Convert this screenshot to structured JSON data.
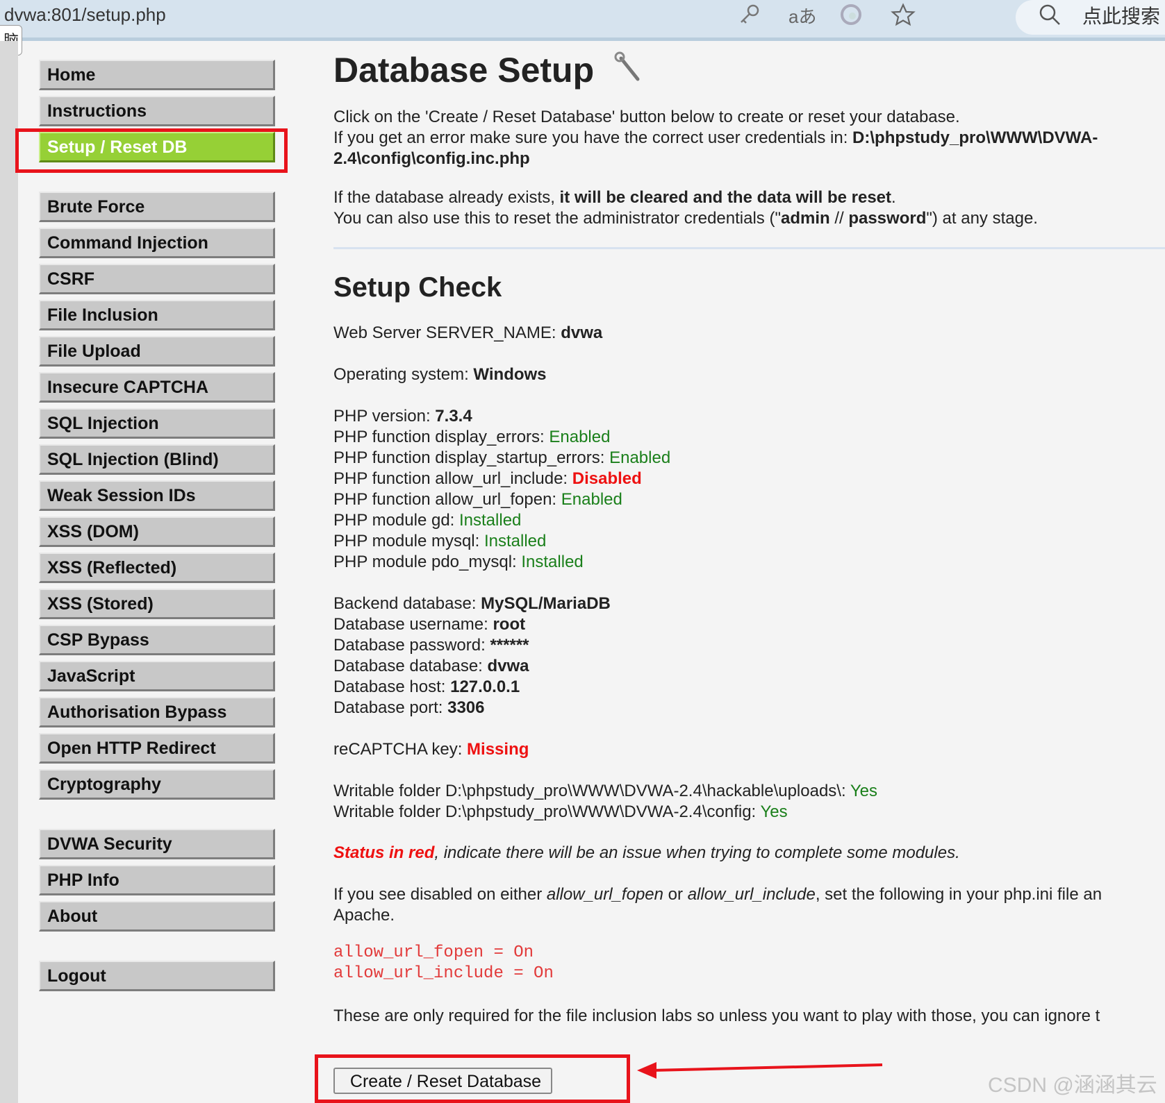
{
  "browser": {
    "url": "dvwa:801/setup.php",
    "translate_icon": "aあ",
    "search_label": "点此搜索",
    "side_tab_label": "脑"
  },
  "menu": {
    "group1": [
      "Home",
      "Instructions",
      "Setup / Reset DB"
    ],
    "group2": [
      "Brute Force",
      "Command Injection",
      "CSRF",
      "File Inclusion",
      "File Upload",
      "Insecure CAPTCHA",
      "SQL Injection",
      "SQL Injection (Blind)",
      "Weak Session IDs",
      "XSS (DOM)",
      "XSS (Reflected)",
      "XSS (Stored)",
      "CSP Bypass",
      "JavaScript",
      "Authorisation Bypass",
      "Open HTTP Redirect",
      "Cryptography"
    ],
    "group3": [
      "DVWA Security",
      "PHP Info",
      "About"
    ],
    "group4": [
      "Logout"
    ],
    "active": "Setup / Reset DB"
  },
  "main": {
    "title": "Database Setup",
    "intro1": "Click on the 'Create / Reset Database' button below to create or reset your database.",
    "intro2_a": "If you get an error make sure you have the correct user credentials in: ",
    "config_path_line1": "D:\\phpstudy_pro\\WWW\\DVWA-",
    "config_path_line2": "2.4\\config\\config.inc.php",
    "exists_a": "If the database already exists, ",
    "exists_b": "it will be cleared and the data will be reset",
    "exists_c": ".",
    "reset_a": "You can also use this to reset the administrator credentials (\"",
    "reset_admin": "admin",
    "reset_sep": " // ",
    "reset_password": "password",
    "reset_c": "\") at any stage.",
    "setup_check_title": "Setup Check",
    "server_name_label": "Web Server SERVER_NAME: ",
    "server_name_value": "dvwa",
    "os_label": "Operating system: ",
    "os_value": "Windows",
    "php_checks": [
      {
        "label": "PHP version: ",
        "value": "7.3.4",
        "style": "b"
      },
      {
        "label": "PHP function display_errors: ",
        "value": "Enabled",
        "style": "green"
      },
      {
        "label": "PHP function display_startup_errors: ",
        "value": "Enabled",
        "style": "green"
      },
      {
        "label": "PHP function allow_url_include: ",
        "value": "Disabled",
        "style": "red"
      },
      {
        "label": "PHP function allow_url_fopen: ",
        "value": "Enabled",
        "style": "green"
      },
      {
        "label": "PHP module gd: ",
        "value": "Installed",
        "style": "green"
      },
      {
        "label": "PHP module mysql: ",
        "value": "Installed",
        "style": "green"
      },
      {
        "label": "PHP module pdo_mysql: ",
        "value": "Installed",
        "style": "green"
      }
    ],
    "db_checks": [
      {
        "label": "Backend database: ",
        "value": "MySQL/MariaDB",
        "style": "b"
      },
      {
        "label": "Database username: ",
        "value": "root",
        "style": "b"
      },
      {
        "label": "Database password: ",
        "value": "******",
        "style": "b"
      },
      {
        "label": "Database database: ",
        "value": "dvwa",
        "style": "b"
      },
      {
        "label": "Database host: ",
        "value": "127.0.0.1",
        "style": "b"
      },
      {
        "label": "Database port: ",
        "value": "3306",
        "style": "b"
      }
    ],
    "recaptcha_label": "reCAPTCHA key: ",
    "recaptcha_value": "Missing",
    "writable": [
      {
        "label": "Writable folder D:\\phpstudy_pro\\WWW\\DVWA-2.4\\hackable\\uploads\\: ",
        "value": "Yes"
      },
      {
        "label": "Writable folder D:\\phpstudy_pro\\WWW\\DVWA-2.4\\config: ",
        "value": "Yes"
      }
    ],
    "status_red": "Status in red",
    "status_rest": ", indicate there will be an issue when trying to complete some modules.",
    "disabled_a": "If you see disabled on either ",
    "disabled_fopen": "allow_url_fopen",
    "disabled_or": " or ",
    "disabled_include": "allow_url_include",
    "disabled_c": ", set the following in your php.ini file an",
    "disabled_line2": "Apache.",
    "code_lines": [
      "allow_url_fopen = On",
      "allow_url_include = On"
    ],
    "only_required": "These are only required for the file inclusion labs so unless you want to play with those, you can ignore t",
    "create_button": "Create / Reset Database"
  },
  "watermark": "CSDN @涵涵其云",
  "colors": {
    "accent_red": "#e8131b",
    "active_menu": "#96d036",
    "enabled_green": "#1a7f1a",
    "status_red": "#ee1111"
  }
}
